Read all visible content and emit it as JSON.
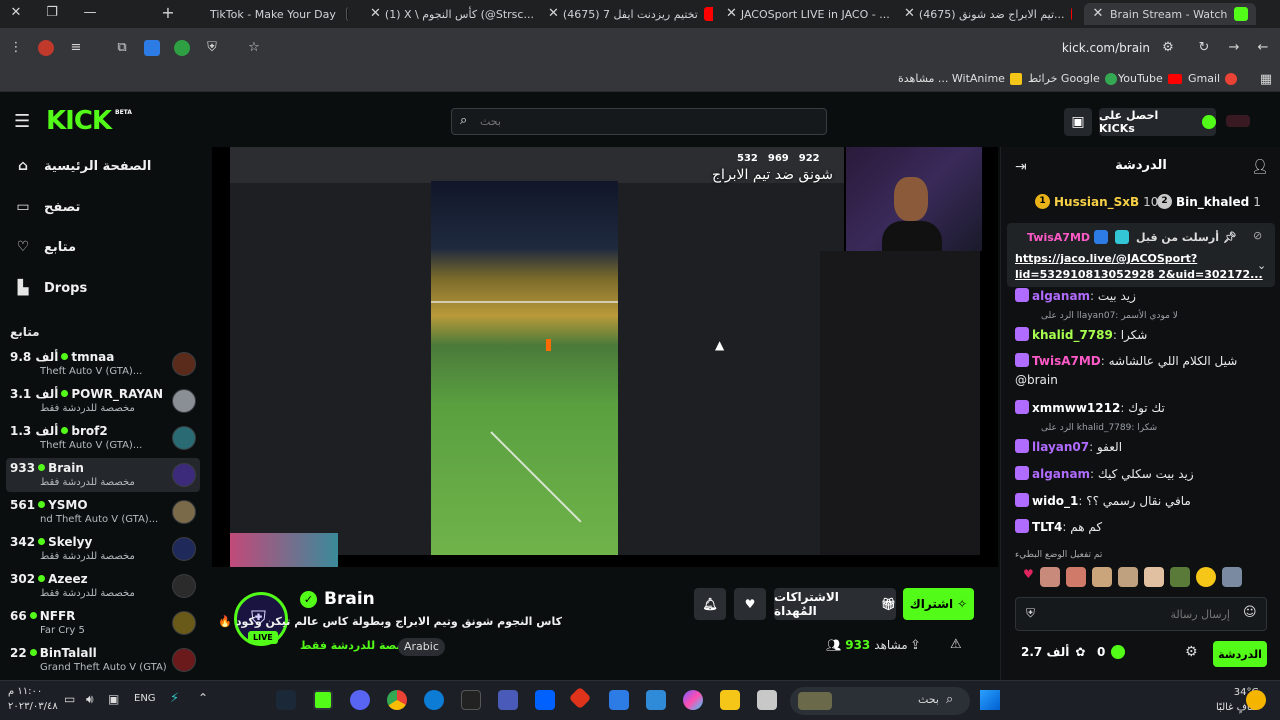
{
  "browser": {
    "tabs": [
      {
        "title": "TikTok - Make Your Day",
        "color": "#111111"
      },
      {
        "title": "(1) X \\ كأس النجوم (@Strsc...",
        "color": "#000000"
      },
      {
        "title": "(4675) تختيم ريزدنت ايفل 7",
        "color": "#ff0000"
      },
      {
        "title": "JACOSport LIVE in JACO - ...",
        "color": "#8a2be2"
      },
      {
        "title": "(4675) تيم الابراج ضد شونق...",
        "color": "#ff0000"
      },
      {
        "title": "Brain Stream - Watch Live on Kick",
        "color": "#53fc18"
      }
    ],
    "url": "kick.com/brain",
    "bookmarks": [
      {
        "label": "Gmail",
        "color": "#ea4335"
      },
      {
        "label": "YouTube",
        "color": "#ff0000"
      },
      {
        "label": "خرائط Google",
        "color": "#34a853"
      },
      {
        "label": "مشاهدة ... WitAnime",
        "color": "#f5c518"
      }
    ],
    "ext_badge": "19"
  },
  "header": {
    "logo": "KICK",
    "logo_sup": "BETA",
    "search_placeholder": "بحث",
    "get_kicks": "احصل على KICKs",
    "accent": "#53fc18"
  },
  "sidebar": {
    "nav": [
      {
        "label": "الصفحة الرئيسية",
        "icon": "home-icon"
      },
      {
        "label": "تصفح",
        "icon": "browse-icon"
      },
      {
        "label": "متابع",
        "icon": "heart-icon"
      },
      {
        "label": "Drops",
        "icon": "drops-icon"
      }
    ],
    "following_title": "متابع",
    "channels": [
      {
        "viewers": "9.8 ألف",
        "name": "tmnaa",
        "category": "Grand Theft Auto V (GTA)",
        "sub_shown": "Theft Auto V (GTA)...",
        "avatar": "#5a2a1a"
      },
      {
        "viewers": "3.1 ألف",
        "name": "POWR_RAYAN",
        "sub_shown": "مخصصة للدردشة فقط",
        "avatar": "#8a8f96"
      },
      {
        "viewers": "1.3 ألف",
        "name": "brof2",
        "sub_shown": "Theft Auto V (GTA)...",
        "avatar": "#2a6b73"
      },
      {
        "viewers": "933",
        "name": "Brain",
        "sub_shown": "مخصصة للدردشة فقط",
        "avatar": "#3b2b7a",
        "active": true
      },
      {
        "viewers": "561",
        "name": "YSMO",
        "sub_shown": "nd Theft Auto V (GTA)...",
        "avatar": "#7a6a4a"
      },
      {
        "viewers": "342",
        "name": "Skelyy",
        "sub_shown": "مخصصة للدردشة فقط",
        "avatar": "#1f2a5a"
      },
      {
        "viewers": "302",
        "name": "Azeez",
        "sub_shown": "مخصصة للدردشة فقط",
        "avatar": "#2b2b2b"
      },
      {
        "viewers": "66",
        "name": "NFFR",
        "sub_shown": "Far Cry 5",
        "avatar": "#6a5a1a"
      },
      {
        "viewers": "22",
        "name": "BinTalall",
        "sub_shown": "Grand Theft Auto V (GTA)",
        "avatar": "#6a1a1a"
      }
    ]
  },
  "player": {
    "overlay_title": "شونق ضد تيم الابراج",
    "counts": [
      "532",
      "969",
      "922"
    ]
  },
  "stream": {
    "streamer": "Brain",
    "live": "LIVE",
    "title": "كاس النجوم شونق وتيم الابراج وبطولة كاس عالم تيكن وكود 🔥",
    "category": "مخصصة للدردشة فقط",
    "language": "Arabic",
    "viewers": "933",
    "viewers_label": "مشاهد",
    "subscribe": "اشتراك",
    "gift_subs": "الاشتراكات المُهداة"
  },
  "chat": {
    "title": "الدردشة",
    "top_gifters": [
      {
        "rank": "1",
        "name": "Hussian_SxB",
        "count": "10"
      },
      {
        "rank": "2",
        "name": "Bin_khaled",
        "count": "1"
      }
    ],
    "pinned_by_label": "أرسلت من قبل",
    "pinned_by_user": "TwisA7MD",
    "pinned_link": "https://jaco.live/@JACOSport?lid=532910813052928 2&uid=302172...",
    "pinned_link_line1": "https://jaco.live/@JACOSport?",
    "pinned_link_line2": "lid=532910813052928 2&uid=302172...",
    "messages": [
      {
        "user": "alganam",
        "color": "#b06bff",
        "text": "زيد بيت"
      },
      {
        "reply": "الرد على  llayan07: لا مودي الأسمر"
      },
      {
        "user": "khalid_7789",
        "color": "#a8ff4f",
        "text": "شكرا"
      },
      {
        "user": "TwisA7MD",
        "color": "#ff5ac8",
        "text": "شيل الكلام اللي عالشاشه"
      },
      {
        "plain": "@brain"
      },
      {
        "user": "xmmww1212",
        "color": "#ffffff",
        "text": "تك توك"
      },
      {
        "reply": "الرد على  khalid_7789: شكرا"
      },
      {
        "user": "llayan07",
        "color": "#b06bff",
        "text": "العفو"
      },
      {
        "user": "alganam",
        "color": "#b06bff",
        "text": "زيد بيت سكلي كيك"
      },
      {
        "user": "wido_1",
        "color": "#ffffff",
        "text": "مافي نقال رسمي ؟؟"
      },
      {
        "user": "TLT4",
        "color": "#ffffff",
        "text": "كم هم"
      }
    ],
    "emote_label": "تم تفعيل الوضع البطيء",
    "input_placeholder": "إرسال رسالة",
    "kicks_count": "2.7 ألف",
    "points": "0",
    "send": "الدردشة"
  },
  "taskbar": {
    "clock_time": "١١:٠٠ م",
    "clock_date": "٢٠٢٣/٠٣/٤٨",
    "lang": "ENG",
    "search": "بحث",
    "weather_temp": "34°C",
    "weather_desc": "صافٍ غالبًا"
  }
}
